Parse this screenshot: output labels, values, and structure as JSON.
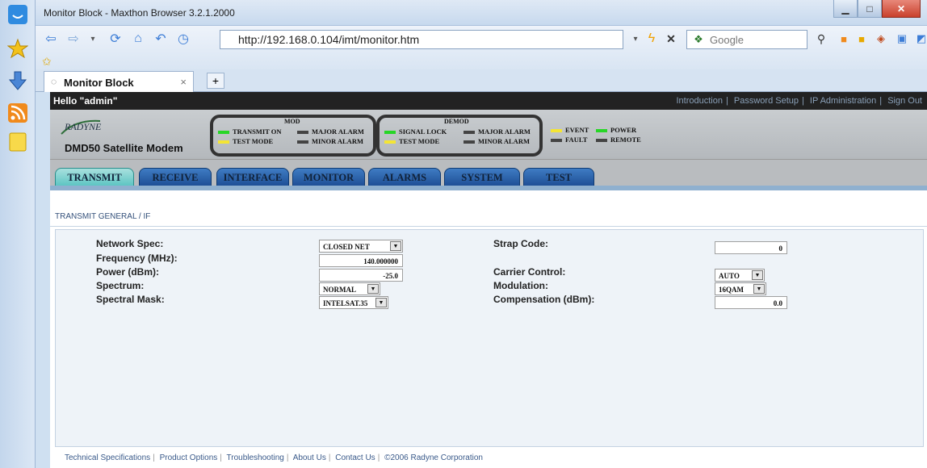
{
  "window": {
    "title": "Monitor Block - Maxthon Browser 3.2.1.2000"
  },
  "browser": {
    "url": "http://192.168.0.104/imt/monitor.htm",
    "search_placeholder": "Google",
    "tab_label": "Monitor Block",
    "tab_close": "×",
    "new_tab": "+"
  },
  "userbar": {
    "greeting": "Hello \"admin\"",
    "links": [
      "Introduction",
      "Password Setup",
      "IP Administration",
      "Sign Out"
    ]
  },
  "header": {
    "logo_text": "RADYNE",
    "product": "DMD50 Satellite Modem",
    "mod_title": "MOD",
    "demod_title": "DEMOD",
    "mod_leds": [
      {
        "label": "TRANSMIT ON",
        "color": "#27d627"
      },
      {
        "label": "MAJOR ALARM",
        "color": "#444444"
      },
      {
        "label": "TEST MODE",
        "color": "#f4e534"
      },
      {
        "label": "MINOR ALARM",
        "color": "#444444"
      }
    ],
    "demod_leds": [
      {
        "label": "SIGNAL LOCK",
        "color": "#27d627"
      },
      {
        "label": "MAJOR ALARM",
        "color": "#444444"
      },
      {
        "label": "TEST MODE",
        "color": "#f4e534"
      },
      {
        "label": "MINOR ALARM",
        "color": "#444444"
      }
    ],
    "misc_leds": [
      {
        "label": "EVENT",
        "color": "#f4e534"
      },
      {
        "label": "POWER",
        "color": "#27d627"
      },
      {
        "label": "FAULT",
        "color": "#444444"
      },
      {
        "label": "REMOTE",
        "color": "#444444"
      }
    ]
  },
  "nav": {
    "tabs": [
      "TRANSMIT",
      "RECEIVE",
      "INTERFACE",
      "MONITOR",
      "ALARMS",
      "SYSTEM",
      "TEST"
    ],
    "active": "TRANSMIT"
  },
  "section": {
    "title": "TRANSMIT GENERAL / IF"
  },
  "form": {
    "network_spec": {
      "label": "Network Spec:",
      "value": "CLOSED NET"
    },
    "frequency": {
      "label": "Frequency (MHz):",
      "value": "140.000000"
    },
    "power": {
      "label": "Power (dBm):",
      "value": "-25.0"
    },
    "spectrum": {
      "label": "Spectrum:",
      "value": "NORMAL"
    },
    "spectral_mask": {
      "label": "Spectral Mask:",
      "value": "INTELSAT.35"
    },
    "strap_code": {
      "label": "Strap Code:",
      "value": "0"
    },
    "carrier_control": {
      "label": "Carrier Control:",
      "value": "AUTO"
    },
    "modulation": {
      "label": "Modulation:",
      "value": "16QAM"
    },
    "compensation": {
      "label": "Compensation (dBm):",
      "value": "0.0"
    }
  },
  "footer": {
    "links": [
      "Technical Specifications",
      "Product Options",
      "Troubleshooting",
      "About Us",
      "Contact Us"
    ],
    "copyright": "©2006 Radyne Corporation"
  }
}
